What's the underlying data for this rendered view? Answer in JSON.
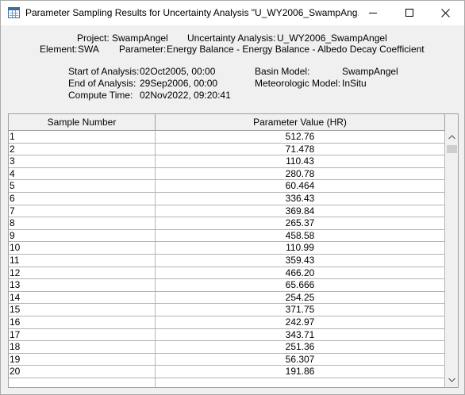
{
  "window": {
    "title": "Parameter Sampling Results for Uncertainty Analysis \"U_WY2006_SwampAng..."
  },
  "info": {
    "project_label": "Project:",
    "project_value": "SwampAngel",
    "uncertainty_label": "Uncertainty Analysis:",
    "uncertainty_value": "U_WY2006_SwampAngel",
    "element_label": "Element:",
    "element_value": "SWA",
    "parameter_label": "Parameter:",
    "parameter_value": "Energy Balance - Energy Balance - Albedo Decay Coefficient",
    "start_label": "Start of Analysis:",
    "start_value": "02Oct2005, 00:00",
    "end_label": "End of Analysis:",
    "end_value": "29Sep2006, 00:00",
    "compute_label": "Compute Time:",
    "compute_value": "02Nov2022, 09:20:41",
    "basin_label": "Basin Model:",
    "basin_value": "SwampAngel",
    "met_label": "Meteorologic Model:",
    "met_value": "InSitu"
  },
  "table": {
    "columns": [
      "Sample Number",
      "Parameter Value (HR)"
    ],
    "rows": [
      [
        "1",
        "512.76"
      ],
      [
        "2",
        "71.478"
      ],
      [
        "3",
        "110.43"
      ],
      [
        "4",
        "280.78"
      ],
      [
        "5",
        "60.464"
      ],
      [
        "6",
        "336.43"
      ],
      [
        "7",
        "369.84"
      ],
      [
        "8",
        "265.37"
      ],
      [
        "9",
        "458.58"
      ],
      [
        "10",
        "110.99"
      ],
      [
        "11",
        "359.43"
      ],
      [
        "12",
        "466.20"
      ],
      [
        "13",
        "65.666"
      ],
      [
        "14",
        "254.25"
      ],
      [
        "15",
        "371.75"
      ],
      [
        "16",
        "242.97"
      ],
      [
        "17",
        "343.71"
      ],
      [
        "18",
        "251.36"
      ],
      [
        "19",
        "56.307"
      ],
      [
        "20",
        "191.86"
      ],
      [
        "",
        ""
      ]
    ]
  },
  "icons": {
    "app": "table-icon",
    "minimize": "minimize-icon",
    "maximize": "maximize-icon",
    "close": "close-icon",
    "scroll_up": "chevron-up-icon",
    "scroll_down": "chevron-down-icon"
  }
}
